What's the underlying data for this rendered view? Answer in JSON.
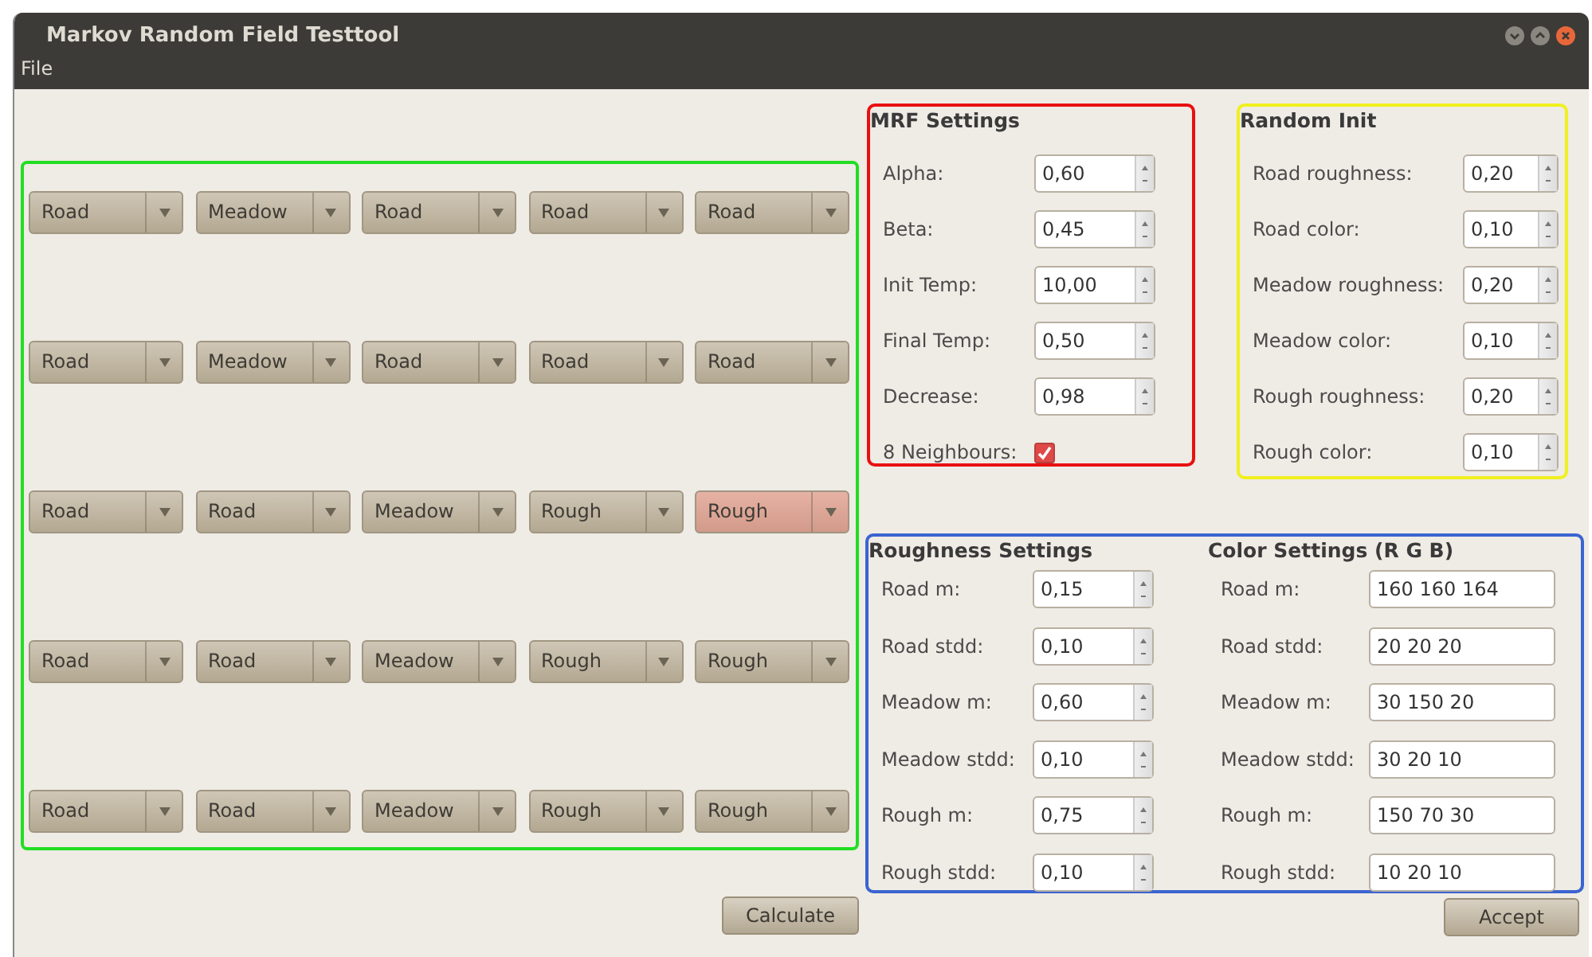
{
  "window": {
    "title": "Markov Random Field Testtool"
  },
  "menu": [
    "File"
  ],
  "grid": {
    "color": "#22dd22",
    "rows": [
      [
        {
          "value": "Road",
          "highlighted": false
        },
        {
          "value": "Meadow",
          "highlighted": false
        },
        {
          "value": "Road",
          "highlighted": false
        },
        {
          "value": "Road",
          "highlighted": false
        },
        {
          "value": "Road",
          "highlighted": false
        }
      ],
      [
        {
          "value": "Road",
          "highlighted": false
        },
        {
          "value": "Meadow",
          "highlighted": false
        },
        {
          "value": "Road",
          "highlighted": false
        },
        {
          "value": "Road",
          "highlighted": false
        },
        {
          "value": "Road",
          "highlighted": false
        }
      ],
      [
        {
          "value": "Road",
          "highlighted": false
        },
        {
          "value": "Road",
          "highlighted": false
        },
        {
          "value": "Meadow",
          "highlighted": false
        },
        {
          "value": "Rough",
          "highlighted": false
        },
        {
          "value": "Rough",
          "highlighted": true
        }
      ],
      [
        {
          "value": "Road",
          "highlighted": false
        },
        {
          "value": "Road",
          "highlighted": false
        },
        {
          "value": "Meadow",
          "highlighted": false
        },
        {
          "value": "Rough",
          "highlighted": false
        },
        {
          "value": "Rough",
          "highlighted": false
        }
      ],
      [
        {
          "value": "Road",
          "highlighted": false
        },
        {
          "value": "Road",
          "highlighted": false
        },
        {
          "value": "Meadow",
          "highlighted": false
        },
        {
          "value": "Rough",
          "highlighted": false
        },
        {
          "value": "Rough",
          "highlighted": false
        }
      ]
    ]
  },
  "calculate_button": "Calculate",
  "mrf_settings": {
    "title": "MRF Settings",
    "color": "#e81010",
    "fields": [
      {
        "kind": "spin",
        "label": "Alpha:",
        "value": "0,60"
      },
      {
        "kind": "spin",
        "label": "Beta:",
        "value": "0,45"
      },
      {
        "kind": "spin",
        "label": "Init Temp:",
        "value": "10,00"
      },
      {
        "kind": "spin",
        "label": "Final Temp:",
        "value": "0,50"
      },
      {
        "kind": "spin",
        "label": "Decrease:",
        "value": "0,98"
      },
      {
        "kind": "checkbox",
        "label": "8 Neighbours:",
        "checked": true
      }
    ]
  },
  "random_init": {
    "title": "Random Init",
    "color": "#f0f020",
    "fields": [
      {
        "kind": "spin",
        "label": "Road roughness:",
        "value": "0,20"
      },
      {
        "kind": "spin",
        "label": "Road color:",
        "value": "0,10"
      },
      {
        "kind": "spin",
        "label": "Meadow roughness:",
        "value": "0,20"
      },
      {
        "kind": "spin",
        "label": "Meadow color:",
        "value": "0,10"
      },
      {
        "kind": "spin",
        "label": "Rough roughness:",
        "value": "0,20"
      },
      {
        "kind": "spin",
        "label": "Rough color:",
        "value": "0,10"
      }
    ]
  },
  "lower_panel": {
    "color": "#3a64d0",
    "roughness_settings": {
      "title": "Roughness Settings",
      "fields": [
        {
          "kind": "spin",
          "label": "Road m:",
          "value": "0,15"
        },
        {
          "kind": "spin",
          "label": "Road stdd:",
          "value": "0,10"
        },
        {
          "kind": "spin",
          "label": "Meadow m:",
          "value": "0,60"
        },
        {
          "kind": "spin",
          "label": "Meadow stdd:",
          "value": "0,10"
        },
        {
          "kind": "spin",
          "label": "Rough m:",
          "value": "0,75"
        },
        {
          "kind": "spin",
          "label": "Rough stdd:",
          "value": "0,10"
        }
      ]
    },
    "color_settings": {
      "title": "Color Settings (R G B)",
      "fields": [
        {
          "kind": "text",
          "label": "Road m:",
          "value": "160 160 164"
        },
        {
          "kind": "text",
          "label": "Road stdd:",
          "value": "20 20 20"
        },
        {
          "kind": "text",
          "label": "Meadow m:",
          "value": "30 150 20"
        },
        {
          "kind": "text",
          "label": "Meadow stdd:",
          "value": "30 20 10"
        },
        {
          "kind": "text",
          "label": "Rough m:",
          "value": "150 70 30"
        },
        {
          "kind": "text",
          "label": "Rough stdd:",
          "value": "10 20 10"
        }
      ]
    }
  },
  "accept_button": "Accept"
}
